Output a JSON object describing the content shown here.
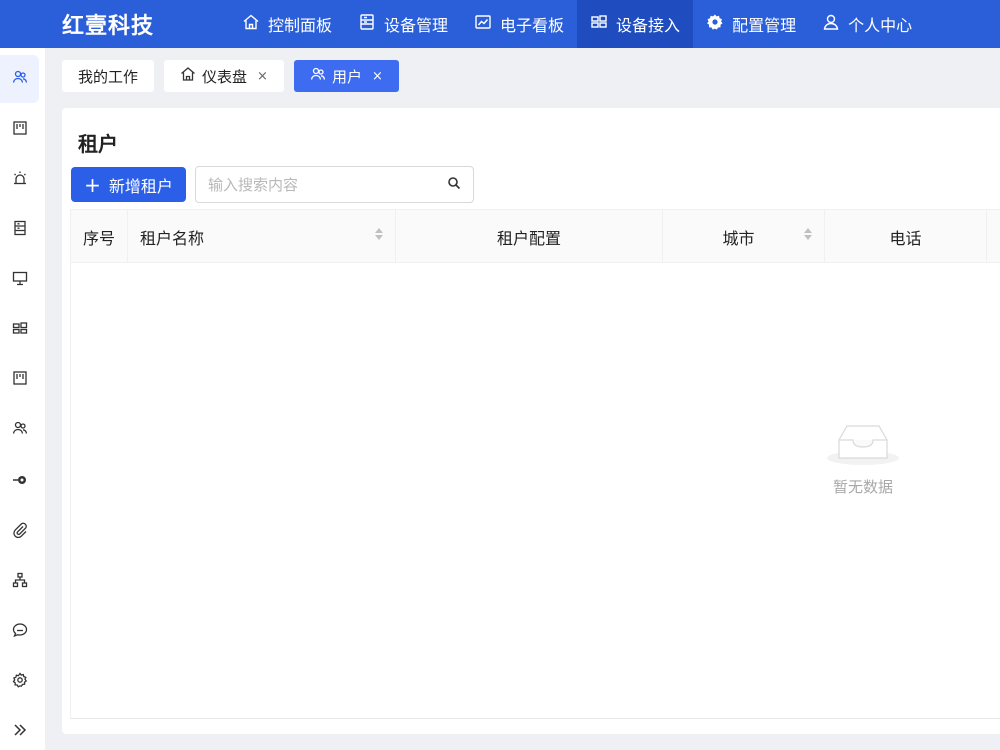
{
  "brand": "红壹科技",
  "nav": [
    {
      "label": "控制面板",
      "icon": "home-icon",
      "active": false
    },
    {
      "label": "设备管理",
      "icon": "server-icon",
      "active": false
    },
    {
      "label": "电子看板",
      "icon": "chart-icon",
      "active": false
    },
    {
      "label": "设备接入",
      "icon": "grid-icon",
      "active": true
    },
    {
      "label": "配置管理",
      "icon": "gear-icon",
      "active": false
    },
    {
      "label": "个人中心",
      "icon": "user-icon",
      "active": false
    }
  ],
  "sidebar": [
    {
      "icon": "users-icon",
      "active": true
    },
    {
      "icon": "kanban-icon",
      "active": false
    },
    {
      "icon": "alarm-icon",
      "active": false
    },
    {
      "icon": "server-icon",
      "active": false
    },
    {
      "icon": "monitor-icon",
      "active": false
    },
    {
      "icon": "grid-icon",
      "active": false
    },
    {
      "icon": "kanban-icon",
      "active": false
    },
    {
      "icon": "users-icon",
      "active": false
    },
    {
      "icon": "key-icon",
      "active": false
    },
    {
      "icon": "paperclip-icon",
      "active": false
    },
    {
      "icon": "sitemap-icon",
      "active": false
    },
    {
      "icon": "chat-icon",
      "active": false
    },
    {
      "icon": "gear-icon",
      "active": false
    },
    {
      "icon": "chevron-double-right-icon",
      "active": false
    }
  ],
  "tabs": [
    {
      "label": "我的工作",
      "icon": "",
      "closable": false,
      "active": false
    },
    {
      "label": "仪表盘",
      "icon": "home-icon",
      "closable": true,
      "active": false
    },
    {
      "label": "用户",
      "icon": "users-icon",
      "closable": true,
      "active": true
    }
  ],
  "tab_close_glyph": "×",
  "page": {
    "title": "租户",
    "add_button": "新增租户",
    "search_placeholder": "输入搜索内容"
  },
  "table": {
    "columns": [
      {
        "label": "序号",
        "sortable": false
      },
      {
        "label": "租户名称",
        "sortable": true
      },
      {
        "label": "租户配置",
        "sortable": false
      },
      {
        "label": "城市",
        "sortable": true
      },
      {
        "label": "电话",
        "sortable": false
      }
    ],
    "rows": [],
    "empty_text": "暂无数据"
  },
  "colors": {
    "topbar": "#2b5fd9",
    "topbar_active": "#1f4dbf",
    "primary_button": "#2b5fe8",
    "active_tab": "#3d6cf0",
    "sidebar_active_icon": "#2b5fe8"
  }
}
